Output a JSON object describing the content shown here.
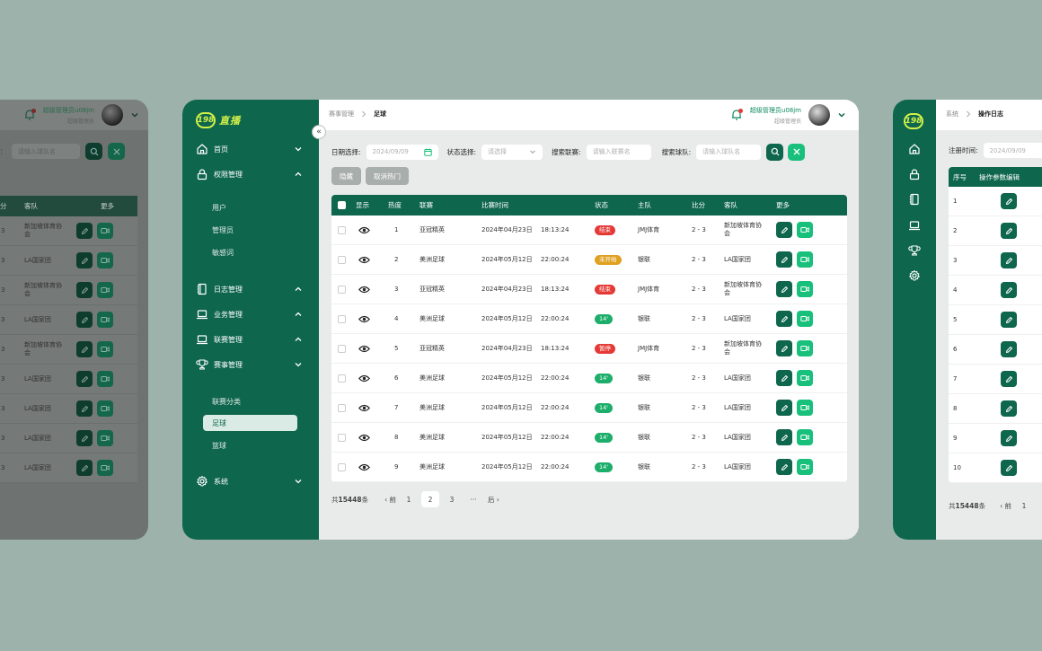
{
  "main": {
    "logo": {
      "badge": "198",
      "text": "直播"
    },
    "sidebar": {
      "items": [
        {
          "label": "首页",
          "icon": "home-icon",
          "chevron": "down"
        },
        {
          "label": "权限管理",
          "icon": "lock-icon",
          "chevron": "up"
        },
        {
          "label": "日志管理",
          "icon": "notebook-icon",
          "chevron": "up"
        },
        {
          "label": "业务管理",
          "icon": "laptop-icon",
          "chevron": "up"
        },
        {
          "label": "联赛管理",
          "icon": "laptop-icon",
          "chevron": "up"
        },
        {
          "label": "赛事管理",
          "icon": "trophy-icon",
          "chevron": "down"
        },
        {
          "label": "系统",
          "icon": "gear-icon",
          "chevron": "down"
        }
      ],
      "permission_sub": [
        "用户",
        "管理员",
        "敏感词"
      ],
      "match_sub": [
        "联赛分类",
        "足球",
        "篮球"
      ],
      "active_sub": "足球"
    },
    "breadcrumb": {
      "parent": "赛事管理",
      "current": "足球"
    },
    "user": {
      "name": "超级管理员u08jm",
      "role": "超级管理员"
    },
    "filters": {
      "date_label": "日期选择:",
      "date_value": "2024/09/09",
      "status_label": "状态选择:",
      "status_placeholder": "请选择",
      "league_label": "搜索联赛:",
      "league_placeholder": "请输入联赛名",
      "team_label": "搜索球队:",
      "team_placeholder": "请输入球队名"
    },
    "actions": {
      "hide": "隐藏",
      "unhot": "取消热门"
    },
    "table": {
      "headers": [
        "显示",
        "热度",
        "联赛",
        "比赛时间",
        "状态",
        "主队",
        "比分",
        "客队",
        "更多"
      ],
      "rows": [
        {
          "heat": "1",
          "league": "亚冠精英",
          "date": "2024年04月23日",
          "time": "18:13:24",
          "status": "结束",
          "status_color": "#e53935",
          "home": "JMJ体育",
          "score": "2 - 3",
          "away": "新加坡体育协会"
        },
        {
          "heat": "2",
          "league": "美洲足球",
          "date": "2024年05月12日",
          "time": "22:00:24",
          "status": "未开始",
          "status_color": "#e0a020",
          "home": "银联",
          "score": "2 - 3",
          "away": "LA国家团"
        },
        {
          "heat": "3",
          "league": "亚冠精英",
          "date": "2024年04月23日",
          "time": "18:13:24",
          "status": "结束",
          "status_color": "#e53935",
          "home": "JMJ体育",
          "score": "2 - 3",
          "away": "新加坡体育协会"
        },
        {
          "heat": "4",
          "league": "美洲足球",
          "date": "2024年05月12日",
          "time": "22:00:24",
          "status": "14'",
          "status_color": "#1cae6a",
          "home": "银联",
          "score": "2 - 3",
          "away": "LA国家团"
        },
        {
          "heat": "5",
          "league": "亚冠精英",
          "date": "2024年04月23日",
          "time": "18:13:24",
          "status": "暂停",
          "status_color": "#e53935",
          "home": "JMJ体育",
          "score": "2 - 3",
          "away": "新加坡体育协会"
        },
        {
          "heat": "6",
          "league": "美洲足球",
          "date": "2024年05月12日",
          "time": "22:00:24",
          "status": "14'",
          "status_color": "#1cae6a",
          "home": "银联",
          "score": "2 - 3",
          "away": "LA国家团"
        },
        {
          "heat": "7",
          "league": "美洲足球",
          "date": "2024年05月12日",
          "time": "22:00:24",
          "status": "14'",
          "status_color": "#1cae6a",
          "home": "银联",
          "score": "2 - 3",
          "away": "LA国家团"
        },
        {
          "heat": "8",
          "league": "美洲足球",
          "date": "2024年05月12日",
          "time": "22:00:24",
          "status": "14'",
          "status_color": "#1cae6a",
          "home": "银联",
          "score": "2 - 3",
          "away": "LA国家团"
        },
        {
          "heat": "9",
          "league": "美洲足球",
          "date": "2024年05月12日",
          "time": "22:00:24",
          "status": "14'",
          "status_color": "#1cae6a",
          "home": "银联",
          "score": "2 - 3",
          "away": "LA国家团"
        }
      ]
    },
    "pagination": {
      "total_prefix": "共",
      "total": "15448",
      "total_suffix": "条",
      "prev": "前",
      "pages": [
        "1",
        "2",
        "3",
        "···"
      ],
      "current": "2",
      "next": "后"
    }
  },
  "left": {
    "user": {
      "name": "超级管理员u08jm",
      "role": "超级管理员"
    },
    "search_label": "：",
    "search_placeholder": "请输入球队名",
    "headers": [
      "分",
      "客队",
      "更多"
    ],
    "rows": [
      {
        "score": "3",
        "away": "新加坡体育协会"
      },
      {
        "score": "3",
        "away": "LA国家团"
      },
      {
        "score": "3",
        "away": "新加坡体育协会"
      },
      {
        "score": "3",
        "away": "LA国家团"
      },
      {
        "score": "3",
        "away": "新加坡体育协会"
      },
      {
        "score": "3",
        "away": "LA国家团"
      },
      {
        "score": "3",
        "away": "LA国家团"
      },
      {
        "score": "3",
        "away": "LA国家团"
      },
      {
        "score": "3",
        "away": "LA国家团"
      }
    ]
  },
  "right": {
    "breadcrumb": {
      "parent": "系统",
      "current": "操作日志"
    },
    "filter_label": "注册时间:",
    "filter_value": "2024/09/09",
    "headers": [
      "序号",
      "操作参数编辑"
    ],
    "rows": [
      "1",
      "2",
      "3",
      "4",
      "5",
      "6",
      "7",
      "8",
      "9",
      "10"
    ],
    "pagination": {
      "total_prefix": "共",
      "total": "15448",
      "total_suffix": "条",
      "prev": "前",
      "page": "1"
    }
  },
  "colors": {
    "brand": "#0e664c",
    "accent": "#19c07b",
    "logo": "#d2f04a",
    "bg": "#9db2ab"
  }
}
